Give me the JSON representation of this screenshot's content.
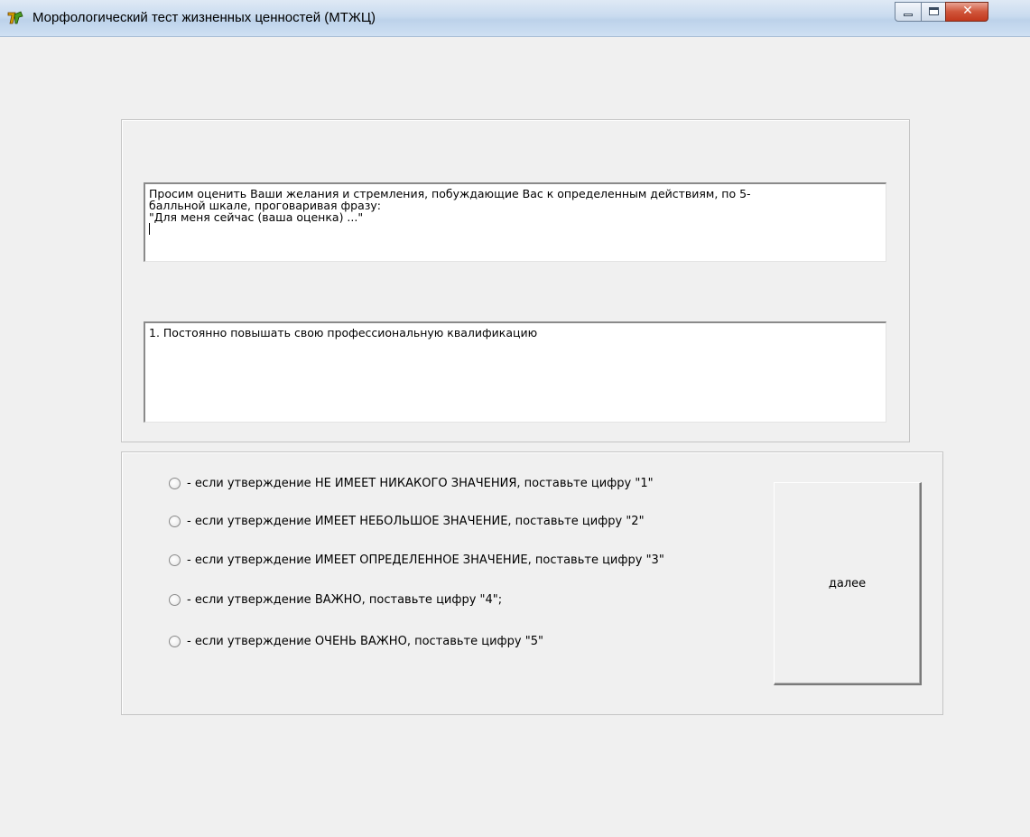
{
  "window": {
    "title": "Морфологический тест жизненных ценностей (МТЖЦ)",
    "controls": {
      "minimize_icon": "minimize-icon",
      "maximize_icon": "maximize-icon",
      "close_icon": "close-icon",
      "close_glyph": "✕"
    },
    "app_icon": "app-logo-icon"
  },
  "instructions": {
    "lines": [
      "Просим оценить Ваши желания и стремления, побуждающие Вас к определенным действиям, по 5-",
      "балльной шкале, проговаривая фразу:",
      "\"Для меня сейчас (ваша оценка) ...\""
    ]
  },
  "question": {
    "text": "1. Постоянно повышать свою профессиональную квалификацию"
  },
  "options": [
    {
      "label": "- если утверждение НЕ ИМЕЕТ НИКАКОГО ЗНАЧЕНИЯ, поставьте цифру \"1\"",
      "selected": false
    },
    {
      "label": "- если утверждение ИМЕЕТ НЕБОЛЬШОЕ ЗНАЧЕНИЕ, поставьте цифру \"2\"",
      "selected": false
    },
    {
      "label": "- если утверждение ИМЕЕТ ОПРЕДЕЛЕННОЕ ЗНАЧЕНИЕ, поставьте цифру \"3\"",
      "selected": false
    },
    {
      "label": "- если утверждение ВАЖНО, поставьте цифру \"4\";",
      "selected": false
    },
    {
      "label": "- если утверждение ОЧЕНЬ ВАЖНО, поставьте цифру \"5\"",
      "selected": false
    }
  ],
  "next_button": {
    "label": "далее"
  },
  "colors": {
    "window_bg": "#f0f0f0",
    "titlebar": "#c9dbef",
    "close_button": "#c9452a"
  }
}
